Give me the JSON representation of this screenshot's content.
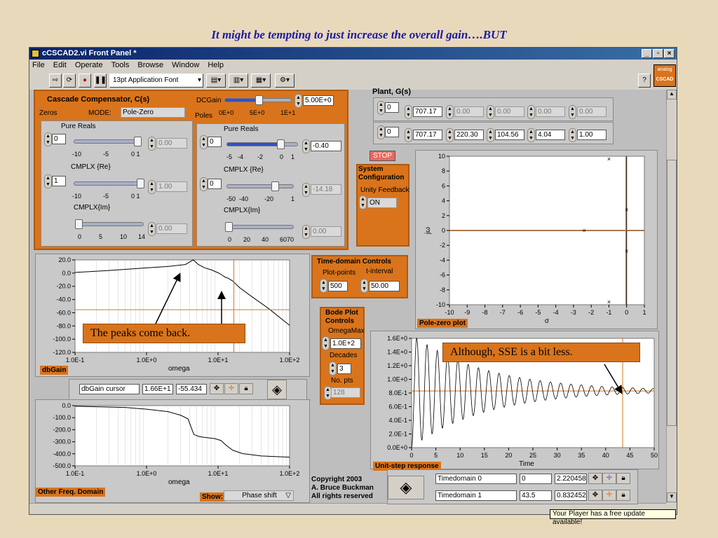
{
  "slide_title": "It might be tempting to just increase the overall gain….BUT",
  "window": {
    "title": "cCSCAD2.vi Front Panel *",
    "menu": [
      "File",
      "Edit",
      "Operate",
      "Tools",
      "Browse",
      "Window",
      "Help"
    ],
    "font_select": "13pt Application Font",
    "logo_line1": "analog",
    "logo_line2": "CSCAD",
    "help_icon": "?"
  },
  "compensator": {
    "title": "Cascade Compensator, C(s)",
    "zeros_label": "Zeros",
    "mode_label": "MODE:",
    "mode_value": "Pole-Zero",
    "dcgain_label": "DCGain",
    "dcgain_value": "5.00E+0",
    "dcgain_ticks": [
      "0E+0",
      "5E+0",
      "1E+1"
    ],
    "poles_label": "Poles",
    "zeros": {
      "pure_label": "Pure Reals",
      "pure_count": "0",
      "pure_value": "0.00",
      "pure_ticks": [
        "-10",
        "-5",
        "0 1"
      ],
      "cmplx_re_label": "CMPLX {Re}",
      "cmplx_count": "1",
      "cmplx_re_value": "1.00",
      "cmplx_re_ticks": [
        "-10",
        "-5",
        "0 1"
      ],
      "cmplx_im_label": "CMPLX{Im}",
      "cmplx_im_value": "0.00",
      "cmplx_im_ticks": [
        "0",
        "5",
        "10",
        "14"
      ]
    },
    "poles": {
      "pure_label": "Pure Reals",
      "pure_count": "0",
      "pure_value": "-0.40",
      "pure_ticks": [
        "-5",
        "-4",
        "-2",
        "0",
        "1"
      ],
      "cmplx_re_label": "CMPLX {Re}",
      "cmplx_count": "0",
      "cmplx_re_value": "-14.18",
      "cmplx_re_ticks": [
        "-50",
        "-40",
        "-20",
        "1"
      ],
      "cmplx_im_label": "CMPLX{Im}",
      "cmplx_im_value": "0.00",
      "cmplx_im_ticks": [
        "0",
        "20",
        "40",
        "6070"
      ]
    }
  },
  "plant": {
    "title": "Plant, G(s)",
    "row1_count": "0",
    "row1": [
      "707.17",
      "0.00",
      "0.00",
      "0.00",
      "0.00"
    ],
    "row2_count": "0",
    "row2": [
      "707.17",
      "220.30",
      "104.56",
      "4.04",
      "1.00"
    ]
  },
  "stop_label": "STOP",
  "system_config": {
    "title": "System Configuration",
    "feedback_label": "Unity Feedback",
    "feedback_value": "ON"
  },
  "pole_zero_plot": {
    "label": "Pole-zero plot",
    "xlabel": "σ",
    "ylabel": "jω",
    "y_ticks": [
      "10",
      "8",
      "6",
      "4",
      "2",
      "0",
      "-2",
      "-4",
      "-6",
      "-8",
      "-10"
    ],
    "x_ticks": [
      "-10",
      "-9",
      "-8",
      "-7",
      "-6",
      "-5",
      "-4",
      "-3",
      "-2",
      "-1",
      "0",
      "1"
    ]
  },
  "time_domain": {
    "title": "Time-domain Controls",
    "plot_points_label": "Plot-points",
    "plot_points_value": "500",
    "t_interval_label": "t-interval",
    "t_interval_value": "50.00"
  },
  "bode_controls": {
    "title": "Bode Plot Controls",
    "omegamax_label": "OmegaMax",
    "omegamax_value": "1.0E+2",
    "decades_label": "Decades",
    "decades_value": "3",
    "npts_label": "No. pts",
    "npts_value": "128"
  },
  "dbgain_plot": {
    "label": "dbGain",
    "xlabel": "omega",
    "y_ticks": [
      "20.0",
      "0.0",
      "-20.0",
      "-40.0",
      "-60.0",
      "-80.0",
      "-100.0",
      "-120.0"
    ],
    "x_ticks": [
      "1.0E-1",
      "1.0E+0",
      "1.0E+1",
      "1.0E+2"
    ],
    "cursor_name": "dbGain cursor",
    "cursor_x": "1.66E+1",
    "cursor_y": "-55.434"
  },
  "other_plot": {
    "label": "Other Freq. Domain",
    "xlabel": "omega",
    "y_ticks": [
      "0.0",
      "-100.0",
      "-200.0",
      "-300.0",
      "-400.0",
      "-500.0"
    ],
    "x_ticks": [
      "1.0E-1",
      "1.0E+0",
      "1.0E+1",
      "1.0E+2"
    ],
    "show_label": "Show:",
    "show_value": "Phase shift"
  },
  "step_plot": {
    "label": "Unit-step response",
    "xlabel": "Time",
    "y_ticks": [
      "1.6E+0",
      "1.4E+0",
      "1.2E+0",
      "1.0E+0",
      "8.0E-1",
      "6.0E-1",
      "4.0E-1",
      "2.0E-1",
      "0.0E+0"
    ],
    "x_ticks": [
      "0",
      "5",
      "10",
      "15",
      "20",
      "25",
      "30",
      "35",
      "40",
      "45",
      "50"
    ],
    "cursor0_name": "Timedomain 0",
    "cursor0_x": "0",
    "cursor0_y": "2.220458",
    "cursor1_name": "Timedomain 1",
    "cursor1_x": "43.5",
    "cursor1_y": "0.832452"
  },
  "callouts": {
    "peaks": "The peaks come back.",
    "sse": "Although, SSE is a bit less."
  },
  "copyright": {
    "line1": "Copyright 2003",
    "line2": "A. Bruce Buckman",
    "line3": "All rights reserved"
  },
  "status_tip": "Your Player has a free update available!"
}
